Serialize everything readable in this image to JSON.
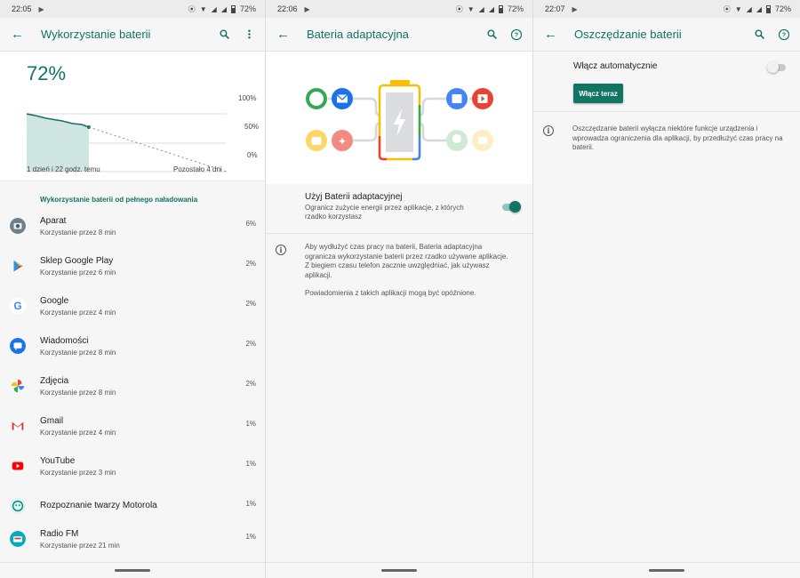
{
  "screens": [
    {
      "status": {
        "time": "22:05",
        "battery": "72%"
      },
      "title": "Wykorzystanie baterii",
      "battery_level": "72%",
      "chart_labels": {
        "left": "1 dzień i 22 godz. temu",
        "right": "Pozostało 4 dni",
        "y100": "100%",
        "y50": "50%",
        "y0": "0%"
      },
      "section_title": "Wykorzystanie baterii od pełnego naładowania",
      "apps": [
        {
          "name": "Aparat",
          "usage": "Korzystanie przez 8 min",
          "pct": "6%",
          "icon": "camera-icon"
        },
        {
          "name": "Sklep Google Play",
          "usage": "Korzystanie przez 6 min",
          "pct": "2%",
          "icon": "play-store-icon"
        },
        {
          "name": "Google",
          "usage": "Korzystanie przez 4 min",
          "pct": "2%",
          "icon": "google-icon"
        },
        {
          "name": "Wiadomości",
          "usage": "Korzystanie przez 8 min",
          "pct": "2%",
          "icon": "messages-icon"
        },
        {
          "name": "Zdjęcia",
          "usage": "Korzystanie przez 8 min",
          "pct": "2%",
          "icon": "photos-icon"
        },
        {
          "name": "Gmail",
          "usage": "Korzystanie przez 4 min",
          "pct": "1%",
          "icon": "gmail-icon"
        },
        {
          "name": "YouTube",
          "usage": "Korzystanie przez 3 min",
          "pct": "1%",
          "icon": "youtube-icon"
        },
        {
          "name": "Rozpoznanie twarzy Motorola",
          "usage": "",
          "pct": "1%",
          "icon": "face-unlock-icon"
        },
        {
          "name": "Radio FM",
          "usage": "Korzystanie przez 21 min",
          "pct": "1%",
          "icon": "radio-icon"
        }
      ]
    },
    {
      "status": {
        "time": "22:06",
        "battery": "72%"
      },
      "title": "Bateria adaptacyjna",
      "toggle_title": "Użyj Baterii adaptacyjnej",
      "toggle_sub": "Ogranicz zużycie energii przez aplikacje, z których rzadko korzystasz",
      "toggle_on": true,
      "info_1": "Aby wydłużyć czas pracy na baterii, Bateria adaptacyjna ogranicza wykorzystanie baterii przez rzadko używane aplikacje. Z biegiem czasu telefon zacznie uwzględniać, jak używasz aplikacji.",
      "info_2": "Powiadomienia z takich aplikacji mogą być opóźnione."
    },
    {
      "status": {
        "time": "22:07",
        "battery": "72%"
      },
      "title": "Oszczędzanie baterii",
      "auto_label": "Włącz automatycznie",
      "auto_on": false,
      "button": "Włącz teraz",
      "info": "Oszczędzanie baterii wyłącza niektóre funkcje urządzenia i wprowadza ograniczenia dla aplikacji, by przedłużyć czas pracy na baterii."
    }
  ],
  "colors": {
    "accent": "#127463",
    "background": "#f6f6f6"
  }
}
